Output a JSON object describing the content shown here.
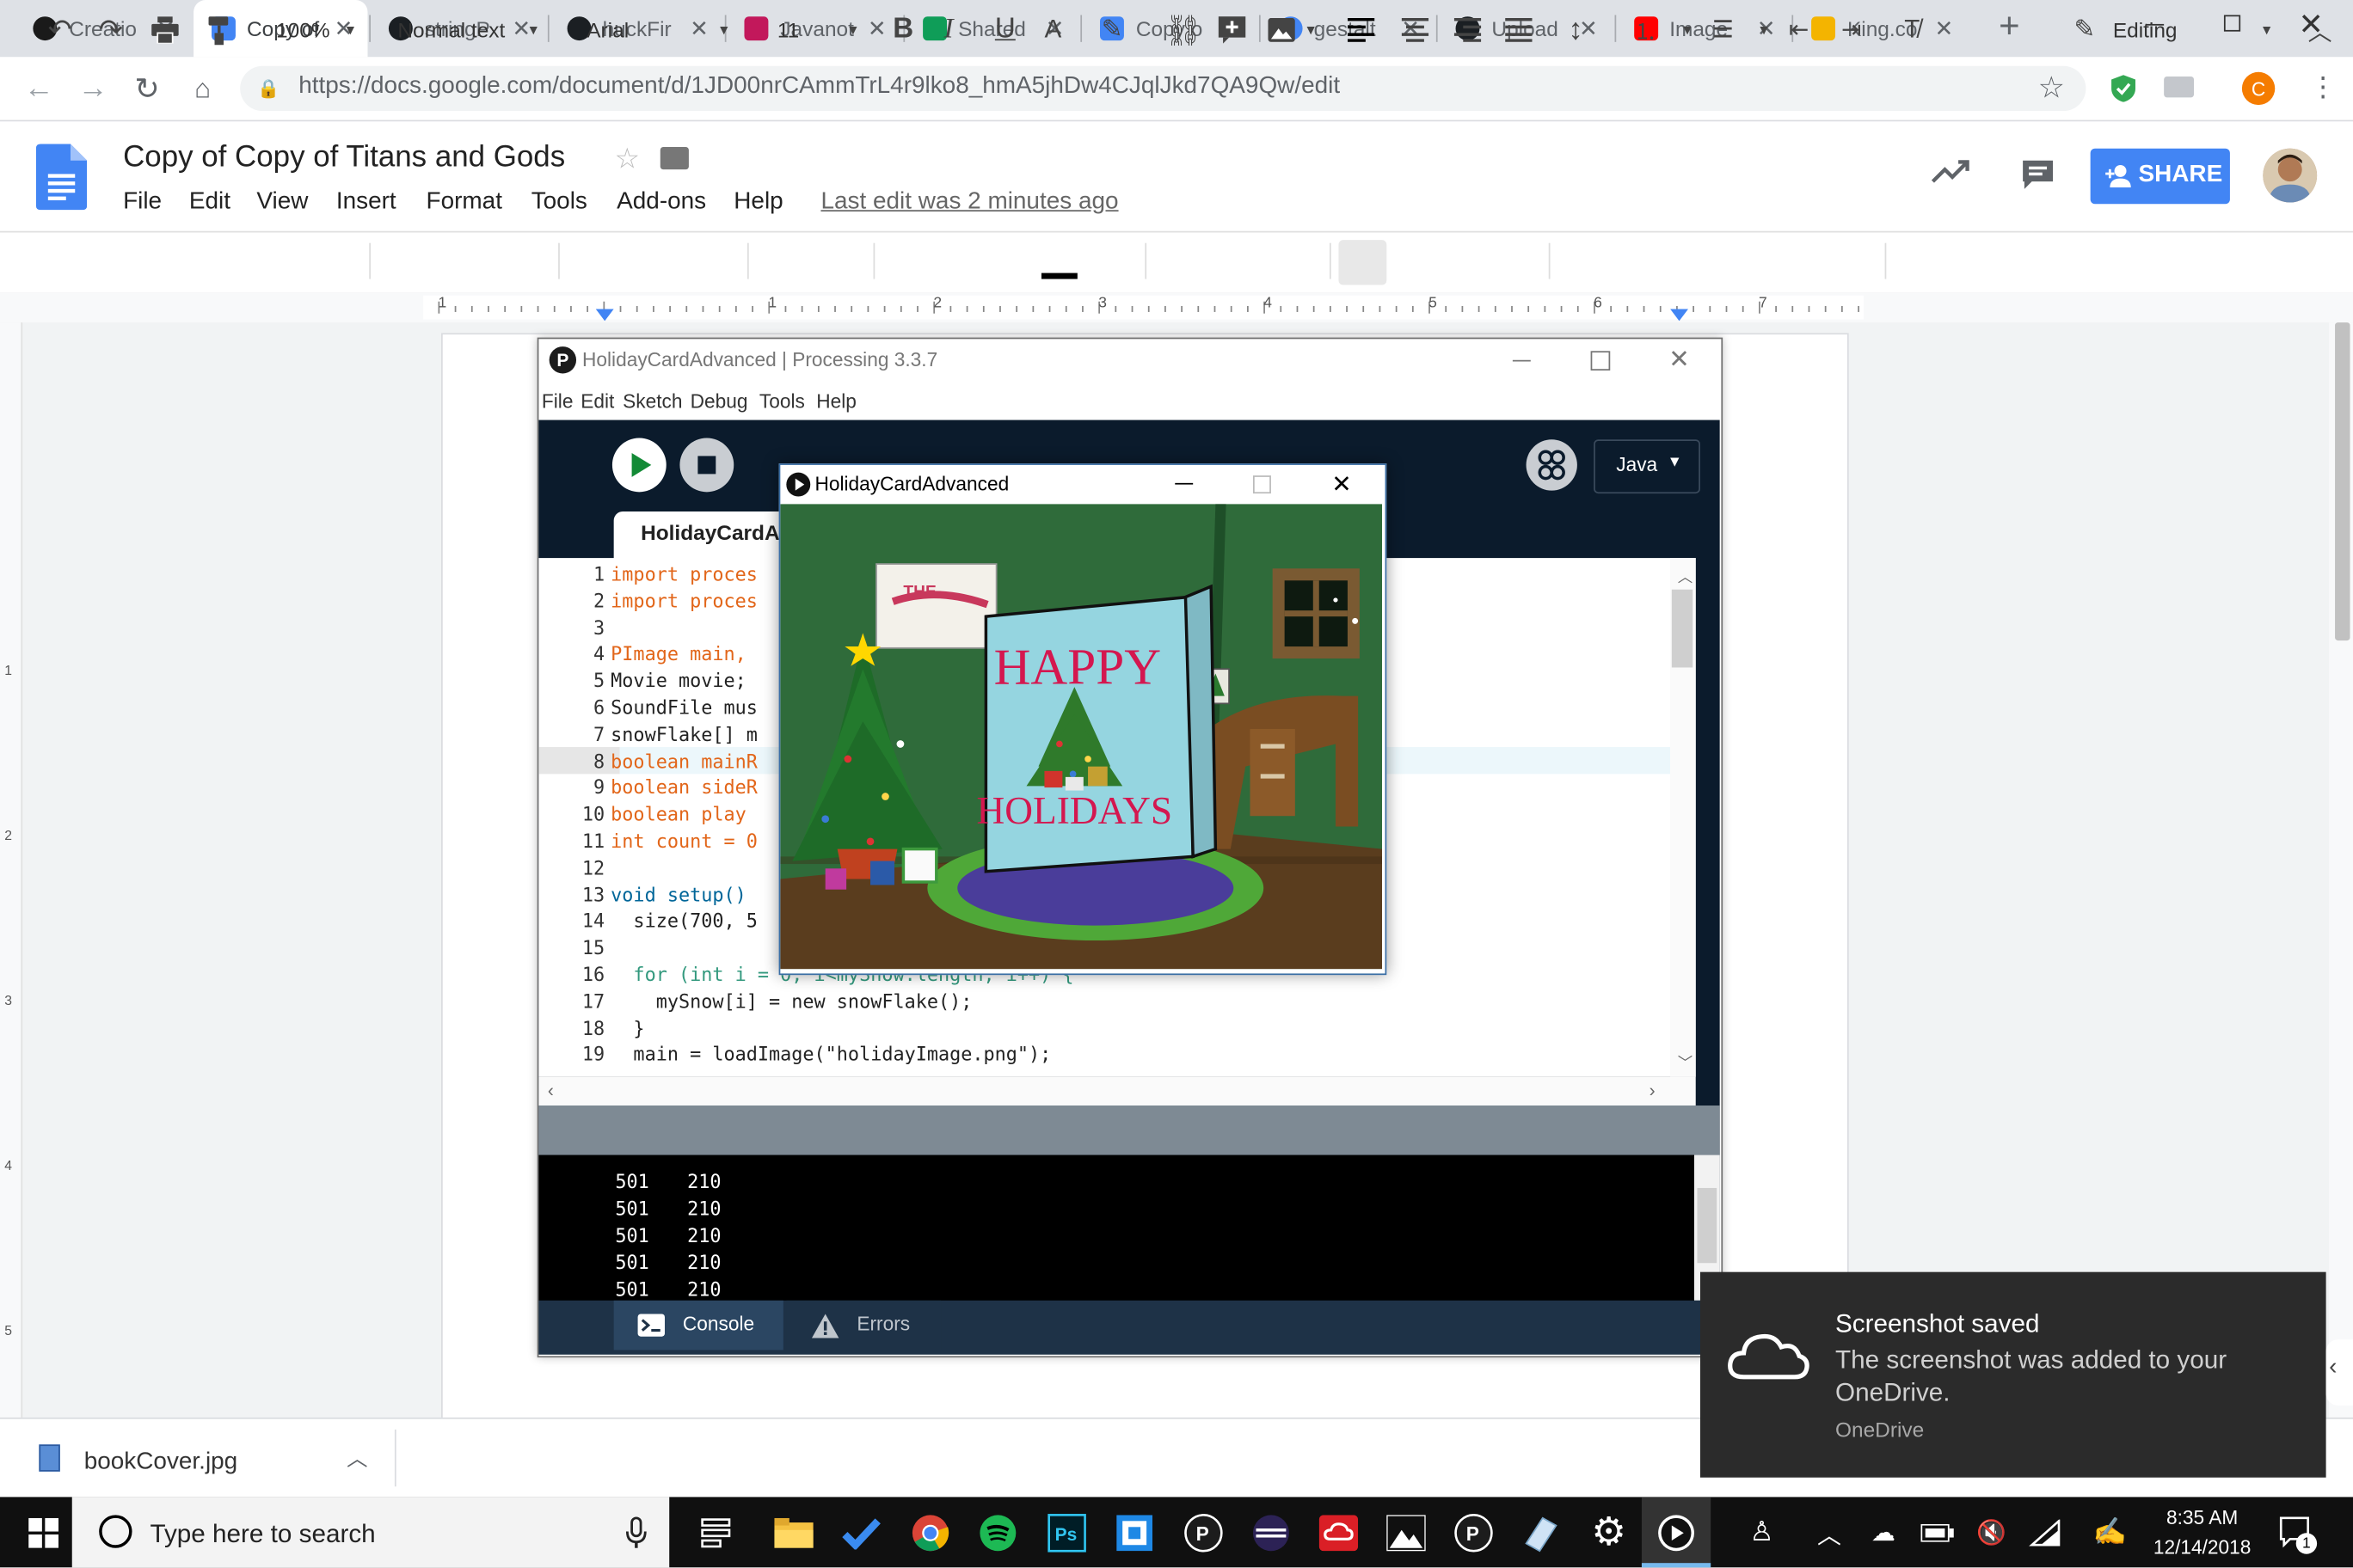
{
  "browser": {
    "tabs": [
      {
        "label": "Creatio",
        "icon": "s-circle-icon",
        "color": "#1a1a1a"
      },
      {
        "label": "Copy of",
        "icon": "docs-icon",
        "color": "#4285f4"
      },
      {
        "label": "stringP",
        "icon": "github-icon",
        "color": "#1b1f23"
      },
      {
        "label": "huckFir",
        "icon": "github-icon",
        "color": "#1b1f23"
      },
      {
        "label": "Javanot",
        "icon": "javanotes-icon",
        "color": "#c2185b"
      },
      {
        "label": "Shared",
        "icon": "drive-icon",
        "color": "#0f9d58"
      },
      {
        "label": "Copy o",
        "icon": "docs-icon",
        "color": "#4285f4"
      },
      {
        "label": "gestalt",
        "icon": "google-icon",
        "color": "#4285f4"
      },
      {
        "label": "Upload",
        "icon": "github-icon",
        "color": "#1b1f23"
      },
      {
        "label": "Image",
        "icon": "youtube-icon",
        "color": "#ff0000"
      },
      {
        "label": "King.co",
        "icon": "crown-icon",
        "color": "#f4b400"
      }
    ],
    "url": "https://docs.google.com/document/d/1JD00nrCAmmTrL4r9lko8_hmA5jhDw4CJqlJkd7QA9Qw/edit",
    "profile_initial": "C"
  },
  "docs": {
    "title": "Copy of Copy of Titans and Gods",
    "menu": [
      "File",
      "Edit",
      "View",
      "Insert",
      "Format",
      "Tools",
      "Add-ons",
      "Help"
    ],
    "last_edit": "Last edit was 2 minutes ago",
    "share_label": "SHARE",
    "toolbar": {
      "zoom": "100%",
      "style": "Normal text",
      "font": "Arial",
      "size": "11",
      "mode": "Editing"
    },
    "ruler_numbers": [
      "1",
      "1",
      "2",
      "3",
      "4",
      "5",
      "6",
      "7"
    ],
    "vruler_numbers": [
      "1",
      "2",
      "3",
      "4",
      "5"
    ]
  },
  "processing": {
    "title": "HolidayCardAdvanced | Processing 3.3.7",
    "menu": [
      "File",
      "Edit",
      "Sketch",
      "Debug",
      "Tools",
      "Help"
    ],
    "mode": "Java",
    "tab_label": "HolidayCardA",
    "code_lines": [
      {
        "n": "1",
        "text": "import proces"
      },
      {
        "n": "2",
        "text": "import proces"
      },
      {
        "n": "3",
        "text": ""
      },
      {
        "n": "4",
        "text": "PImage main, "
      },
      {
        "n": "5",
        "text": "Movie movie;"
      },
      {
        "n": "6",
        "text": "SoundFile mus"
      },
      {
        "n": "7",
        "text": "snowFlake[] m"
      },
      {
        "n": "8",
        "text": "boolean mainR"
      },
      {
        "n": "9",
        "text": "boolean sideR"
      },
      {
        "n": "10",
        "text": "boolean play "
      },
      {
        "n": "11",
        "text": "int count = 0"
      },
      {
        "n": "12",
        "text": ""
      },
      {
        "n": "13",
        "text": "void setup() "
      },
      {
        "n": "14",
        "text": "  size(700, 5"
      },
      {
        "n": "15",
        "text": ""
      },
      {
        "n": "16",
        "text": "  for (int i = 0; i<mySnow.length; i++) {"
      },
      {
        "n": "17",
        "text": "    mySnow[i] = new snowFlake();"
      },
      {
        "n": "18",
        "text": "  }"
      },
      {
        "n": "19",
        "text": "  main = loadImage(\"holidayImage.png\");"
      }
    ],
    "console_lines": [
      {
        "a": "501",
        "b": "210"
      },
      {
        "a": "501",
        "b": "210"
      },
      {
        "a": "501",
        "b": "210"
      },
      {
        "a": "501",
        "b": "210"
      },
      {
        "a": "501",
        "b": "210"
      }
    ],
    "console_tab": "Console",
    "errors_tab": "Errors"
  },
  "sketch": {
    "title": "HolidayCardAdvanced",
    "card_top": "HAPPY",
    "card_bottom": "HOLIDAYS",
    "poster_text": "THE"
  },
  "download": {
    "filename": "bookCover.jpg"
  },
  "toast": {
    "title": "Screenshot saved",
    "body": "The screenshot was added to your OneDrive.",
    "source": "OneDrive"
  },
  "taskbar": {
    "search_placeholder": "Type here to search",
    "time": "8:35 AM",
    "date": "12/14/2018",
    "notification_count": "1"
  }
}
